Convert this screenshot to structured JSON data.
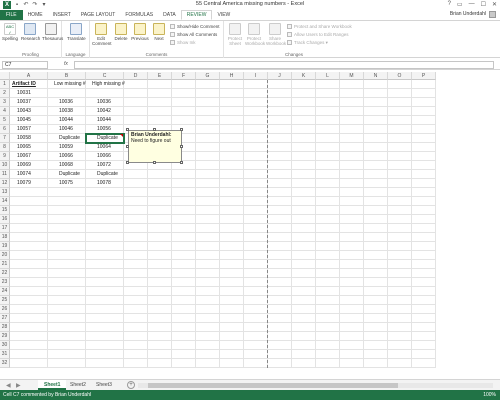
{
  "window": {
    "title": "55 Central America missing numbers - Excel",
    "controls": [
      "?",
      "▭",
      "—",
      "☐",
      "✕"
    ]
  },
  "ribbon_tabs": [
    {
      "label": "FILE"
    },
    {
      "label": "HOME"
    },
    {
      "label": "INSERT"
    },
    {
      "label": "PAGE LAYOUT"
    },
    {
      "label": "FORMULAS"
    },
    {
      "label": "DATA"
    },
    {
      "label": "REVIEW",
      "active": true
    },
    {
      "label": "VIEW"
    }
  ],
  "user": {
    "name": "Brian Underdahl"
  },
  "ribbon": {
    "proofing": {
      "label": "Proofing",
      "abc_label": "ABC",
      "spelling": "Spelling",
      "research": "Research",
      "thesaurus": "Thesaurus"
    },
    "language": {
      "label": "Language",
      "translate": "Translate"
    },
    "comments": {
      "label": "Comments",
      "edit": "Edit",
      "edit2": "Comment",
      "delete": "Delete",
      "previous": "Previous",
      "next": "Next",
      "show_hide": "Show/Hide Comment",
      "show_all": "Show All Comments",
      "show_ink": "Show Ink"
    },
    "changes": {
      "label": "Changes",
      "protect_sheet_1": "Protect",
      "protect_sheet_2": "Sheet",
      "protect_wb_1": "Protect",
      "protect_wb_2": "Workbook",
      "share_1": "Share",
      "share_2": "Workbook",
      "protect_share": "Protect and Share Workbook",
      "allow_users": "Allow Users to Edit Ranges",
      "track_changes": "Track Changes ▾"
    }
  },
  "formula_bar": {
    "name_box": "C7",
    "fx": "fx",
    "value": ""
  },
  "columns": [
    "A",
    "B",
    "C",
    "D",
    "E",
    "F",
    "G",
    "H",
    "I",
    "J",
    "K",
    "L",
    "M",
    "N",
    "O",
    "P"
  ],
  "rows": [
    "1",
    "2",
    "3",
    "4",
    "5",
    "6",
    "7",
    "8",
    "9",
    "10",
    "11",
    "12",
    "13",
    "14",
    "15",
    "16",
    "17",
    "18",
    "19",
    "20",
    "21",
    "22",
    "23",
    "24",
    "25",
    "26",
    "27",
    "28",
    "29",
    "30",
    "31",
    "32"
  ],
  "table": {
    "headers": [
      "Artifact ID",
      "Low missing #",
      "High missing #"
    ],
    "rows": [
      [
        "10031",
        "",
        ""
      ],
      [
        "10037",
        "10036",
        "10036"
      ],
      [
        "10043",
        "10038",
        "10042"
      ],
      [
        "10045",
        "10044",
        "10044"
      ],
      [
        "10057",
        "10046",
        "10056"
      ],
      [
        "10058",
        "Duplicate",
        "Duplicate"
      ],
      [
        "10065",
        "10059",
        "10064"
      ],
      [
        "10067",
        "10066",
        "10066"
      ],
      [
        "10069",
        "10068",
        "10072"
      ],
      [
        "10074",
        "Duplicate",
        "Duplicate"
      ],
      [
        "10079",
        "10075",
        "10078"
      ]
    ]
  },
  "comment": {
    "author": "Brian Underdahl:",
    "text": "Need to figure out"
  },
  "sheets": [
    {
      "label": "Sheet1",
      "active": true
    },
    {
      "label": "Sheet2"
    },
    {
      "label": "Sheet3"
    }
  ],
  "sheet_nav": {
    "prev": "◀",
    "next": "▶",
    "add": "+"
  },
  "status_bar": {
    "text": "Cell C7 commented by Brian Underdahl",
    "zoom": "100%"
  },
  "icons": {
    "accent": "#217346"
  }
}
